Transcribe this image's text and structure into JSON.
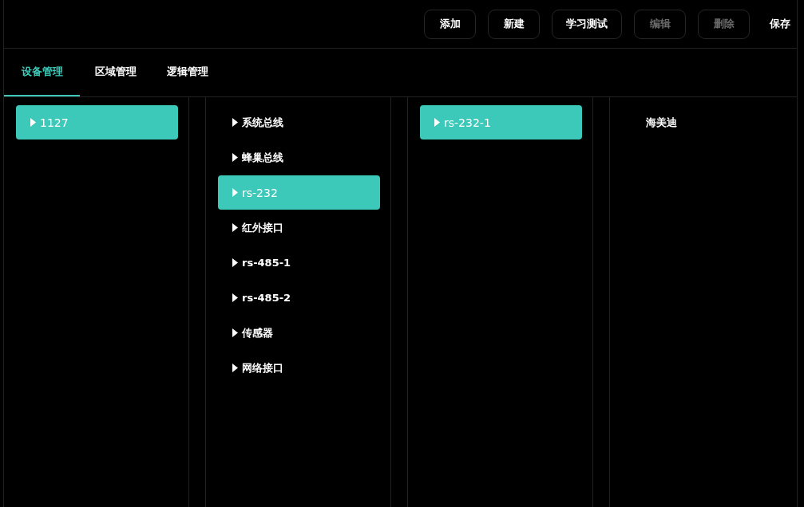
{
  "toolbar": {
    "buttons": [
      {
        "label": "添加",
        "kind": "outlined",
        "disabled": false
      },
      {
        "label": "新建",
        "kind": "outlined",
        "disabled": false
      },
      {
        "label": "学习测试",
        "kind": "outlined",
        "disabled": false
      },
      {
        "label": "编辑",
        "kind": "outlined",
        "disabled": true
      },
      {
        "label": "删除",
        "kind": "outlined",
        "disabled": true
      },
      {
        "label": "保存",
        "kind": "text",
        "disabled": false
      }
    ]
  },
  "tabs": [
    {
      "label": "设备管理",
      "selected": true
    },
    {
      "label": "区域管理",
      "selected": false
    },
    {
      "label": "逻辑管理",
      "selected": false
    }
  ],
  "columns": [
    {
      "items": [
        {
          "label": "1127",
          "selected": true,
          "expandable": true
        }
      ]
    },
    {
      "items": [
        {
          "label": "系统总线",
          "selected": false,
          "expandable": true
        },
        {
          "label": "蜂巢总线",
          "selected": false,
          "expandable": true
        },
        {
          "label": "rs-232",
          "selected": true,
          "expandable": true
        },
        {
          "label": "红外接口",
          "selected": false,
          "expandable": true
        },
        {
          "label": "rs-485-1",
          "selected": false,
          "expandable": true
        },
        {
          "label": "rs-485-2",
          "selected": false,
          "expandable": true
        },
        {
          "label": "传感器",
          "selected": false,
          "expandable": true
        },
        {
          "label": "网络接口",
          "selected": false,
          "expandable": true
        }
      ]
    },
    {
      "items": [
        {
          "label": "rs-232-1",
          "selected": true,
          "expandable": true
        }
      ]
    },
    {
      "items": [
        {
          "label": "海美迪",
          "selected": false,
          "expandable": false
        }
      ]
    }
  ]
}
